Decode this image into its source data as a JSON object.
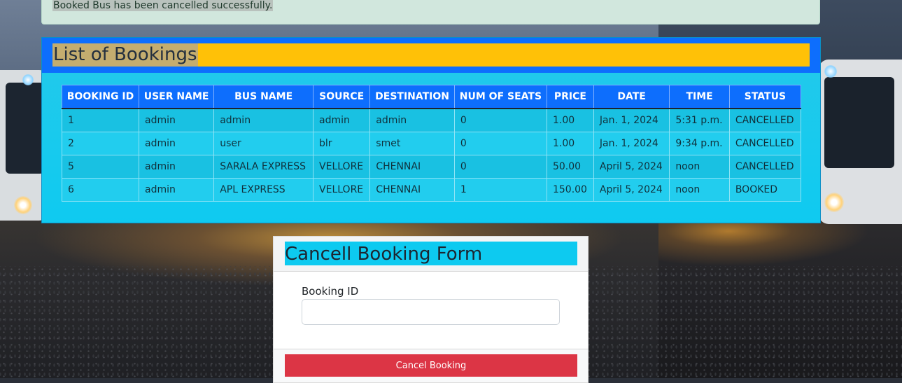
{
  "alert": {
    "message": "Booked Bus has been cancelled successfully."
  },
  "bookings": {
    "title": "List of Bookings",
    "columns": [
      "BOOKING ID",
      "USER NAME",
      "BUS NAME",
      "SOURCE",
      "DESTINATION",
      "NUM OF SEATS",
      "PRICE",
      "DATE",
      "TIME",
      "STATUS"
    ],
    "rows": [
      [
        "1",
        "admin",
        "admin",
        "admin",
        "admin",
        "0",
        "1.00",
        "Jan. 1, 2024",
        "5:31 p.m.",
        "CANCELLED"
      ],
      [
        "2",
        "admin",
        "user",
        "blr",
        "smet",
        "0",
        "1.00",
        "Jan. 1, 2024",
        "9:34 p.m.",
        "CANCELLED"
      ],
      [
        "5",
        "admin",
        "SARALA EXPRESS",
        "VELLORE",
        "CHENNAI",
        "0",
        "50.00",
        "April 5, 2024",
        "noon",
        "CANCELLED"
      ],
      [
        "6",
        "admin",
        "APL EXPRESS",
        "VELLORE",
        "CHENNAI",
        "1",
        "150.00",
        "April 5, 2024",
        "noon",
        "BOOKED"
      ]
    ]
  },
  "cancel_form": {
    "title": "Cancell Booking Form",
    "field_label": "Booking ID",
    "field_value": "",
    "button_label": "Cancel Booking"
  },
  "colors": {
    "card_header": "#0d6efd",
    "title_bar": "#ffc107",
    "card_body": "#0dcaf0",
    "danger": "#dc3545",
    "alert_bg": "#d1e7dd"
  }
}
